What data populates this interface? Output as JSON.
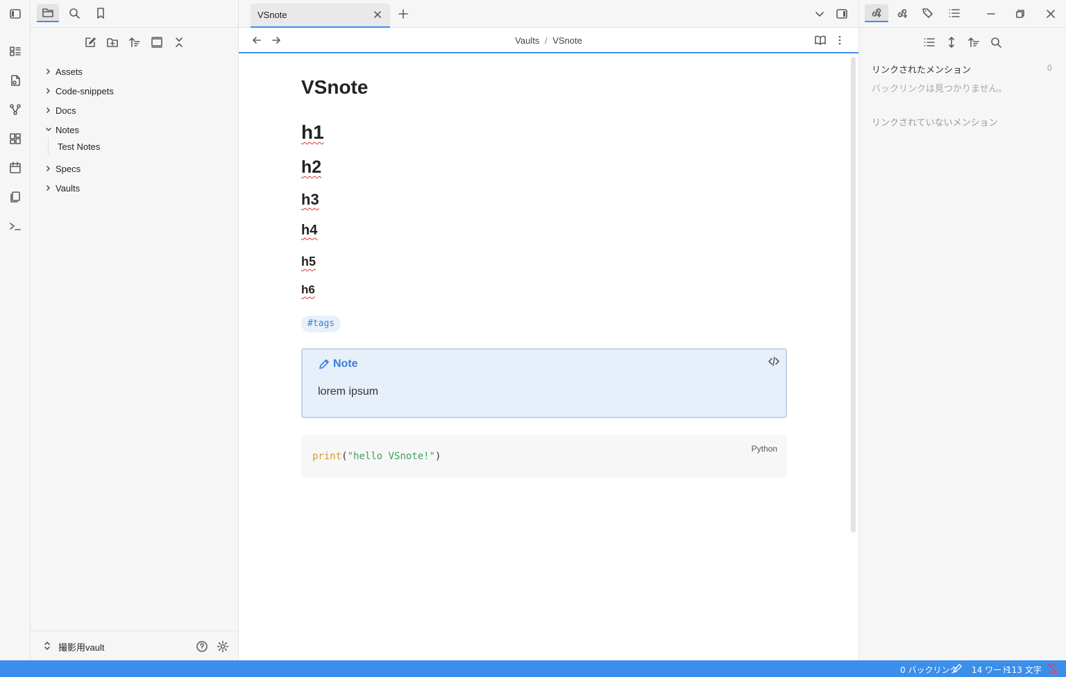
{
  "left_sidebar": {
    "tree": [
      {
        "label": "Assets",
        "expanded": false
      },
      {
        "label": "Code-snippets",
        "expanded": false
      },
      {
        "label": "Docs",
        "expanded": false
      },
      {
        "label": "Notes",
        "expanded": true,
        "children": [
          "Test Notes"
        ]
      },
      {
        "label": "Specs",
        "expanded": false
      },
      {
        "label": "Vaults",
        "expanded": false
      }
    ],
    "vault_name": "撮影用vault"
  },
  "tab": {
    "title": "VSnote"
  },
  "breadcrumb": {
    "folder": "Vaults",
    "separator": "/",
    "file": "VSnote"
  },
  "note": {
    "title": "VSnote",
    "headings": [
      "h1",
      "h2",
      "h3",
      "h4",
      "h5",
      "h6"
    ],
    "tag": "#tags",
    "callout": {
      "title": "Note",
      "body": "lorem ipsum"
    },
    "code": {
      "language": "Python",
      "func": "print",
      "open": "(",
      "string": "\"hello VSnote!\"",
      "close": ")"
    }
  },
  "right_sidebar": {
    "linked_mentions": "リンクされたメンション",
    "linked_count": "0",
    "no_backlinks": "バックリンクは見つかりません。",
    "unlinked_mentions": "リンクされていないメンション"
  },
  "status_bar": {
    "backlinks": "0 バックリンク",
    "words": "14 ワード",
    "chars": "113 文字"
  },
  "colors": {
    "accent": "#3b8eea",
    "callout_bg": "#e6effa",
    "tag_bg": "#e8f0fb",
    "code_func": "#d79a2a",
    "code_string": "#3aa35a"
  }
}
